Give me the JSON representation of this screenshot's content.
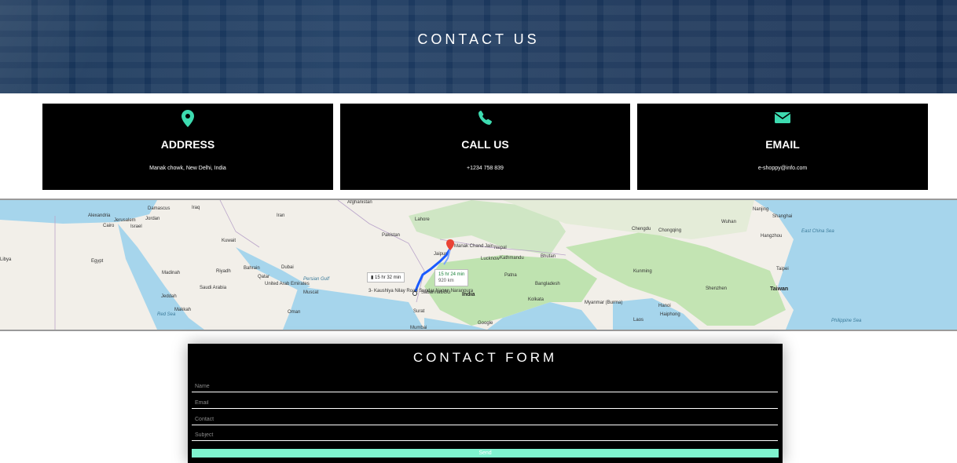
{
  "hero": {
    "title": "CONTACT US"
  },
  "cards": [
    {
      "icon": "map-marker-icon",
      "title": "ADDRESS",
      "text": "Manak chowk, New Delhi, India"
    },
    {
      "icon": "phone-icon",
      "title": "CALL US",
      "text": "+1234 758 839"
    },
    {
      "icon": "envelope-icon",
      "title": "EMAIL",
      "text": "e-shoppy@info.com"
    }
  ],
  "map": {
    "labels": {
      "afghanistan": "Afghanistan",
      "pakistan": "Pakistan",
      "iran": "Iran",
      "iraq": "Iraq",
      "egypt": "Egypt",
      "libya": "Libya",
      "saudi": "Saudi Arabia",
      "kuwait": "Kuwait",
      "bahrain": "Bahrain",
      "qatar": "Qatar",
      "uae": "United Arab Emirates",
      "oman": "Oman",
      "india": "India",
      "nepal": "Nepal",
      "bhutan": "Bhutan",
      "bangladesh": "Bangladesh",
      "myanmar": "Myanmar (Burma)",
      "laos": "Laos",
      "taiwan": "Taiwan",
      "jordan": "Jordan",
      "israel": "Israel",
      "alexandria": "Alexandria",
      "cairo": "Cairo",
      "jerusalem": "Jerusalem",
      "damascus": "Damascus",
      "riyadh": "Riyadh",
      "madinah": "Madinah",
      "jeddah": "Jeddah",
      "makkah": "Makkah",
      "muscat": "Muscat",
      "doha": "Doha",
      "dubai": "Dubai",
      "lahore": "Lahore",
      "jaipur": "Jaipur",
      "lucknow": "Lucknow",
      "kathmandu": "Kathmandu",
      "patna": "Patna",
      "kolkata": "Kolkata",
      "surat": "Surat",
      "mumbai": "Mumbai",
      "chengdu": "Chengdu",
      "chongqing": "Chongqing",
      "wuhan": "Wuhan",
      "nanjing": "Nanjing",
      "shanghai": "Shanghai",
      "hangzhou": "Hangzhou",
      "taipei": "Taipei",
      "kunming": "Kunming",
      "shenzhen": "Shenzhen",
      "hanoi": "Hanoi",
      "haiphong": "Haiphong",
      "persian_gulf": "Persian Gulf",
      "red_sea": "Red Sea",
      "east_china_sea": "East China Sea",
      "philippine_sea": "Philippine Sea",
      "destination": "Manak Chand Jain",
      "origin": "3- Kaushlya Nilay Road Sundar Nagar, Naranpura",
      "sabarmati": "Sabarmati BG",
      "google": "Google"
    },
    "route_primary": "15 hr 32 min",
    "route_alt": "15 hr 24 min",
    "route_alt_dist": "920 km"
  },
  "form": {
    "title": "CONTACT FORM",
    "name_placeholder": "Name",
    "email_placeholder": "Email",
    "contact_placeholder": "Contact",
    "subject_placeholder": "Subject",
    "send_label": "Send"
  },
  "colors": {
    "accent": "#3ddbb0",
    "send_button": "#7ff3cf",
    "hero": "#1b365a"
  }
}
